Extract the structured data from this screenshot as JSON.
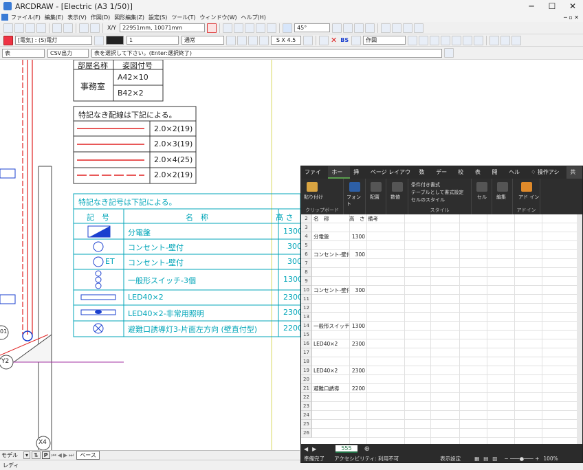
{
  "window": {
    "title": "ARCDRAW - [Electric (A3 1/50)]"
  },
  "menu": [
    "ファイル(F)",
    "編集(E)",
    "表示(V)",
    "作図(D)",
    "図形編集(Z)",
    "設定(S)",
    "ツール(T)",
    "ウィンドウ(W)",
    "ヘルプ(H)"
  ],
  "toolbar1": {
    "coord_label": "X/Y",
    "coord_value": "22951mm,    10071mm",
    "angle_value": "45°"
  },
  "toolbar2": {
    "layer_value": "[電気] : (S)電灯",
    "line_value": "1",
    "linetype_value": "通常",
    "scale_value": "S X 4.5",
    "bs_label": "BS",
    "mode_value": "作図"
  },
  "toolbar3": {
    "type_value": "表",
    "output_value": "CSV出力",
    "prompt_text": "表を選択して下さい。(Enter:選択終了)"
  },
  "cad": {
    "room_table": {
      "header_room": "部屋名称",
      "header_code": "姿図付号",
      "room": "事務室",
      "row1": "A42×10",
      "row2": "B42×2"
    },
    "wire_table": {
      "title": "特記なき配線は下記による。",
      "rows": [
        "2.0×2(19)",
        "2.0×3(19)",
        "2.0×4(25)",
        "2.0×2(19)"
      ]
    },
    "symbol_table": {
      "title": "特記なき記号は下記による。",
      "col_symbol": "記　号",
      "col_name": "名　称",
      "col_height": "高 さ",
      "rows": [
        {
          "name": "分電盤",
          "height": "1300"
        },
        {
          "name": "コンセント-壁付",
          "height": "300"
        },
        {
          "name": "コンセント-壁付",
          "height": "300",
          "symbol_text": "ET"
        },
        {
          "name": "一般形スイッチ-3個",
          "height": "1300"
        },
        {
          "name": "LED40×2",
          "height": "2300"
        },
        {
          "name": "LED40×2-非常用照明",
          "height": "2300"
        },
        {
          "name": "避難口誘導灯3-片面左方向 (壁直付型)",
          "height": "2200"
        }
      ]
    },
    "labels": {
      "y2": "Y2",
      "x4": "X4",
      "n01": "01"
    }
  },
  "bottom_tabs": {
    "model": "モデル",
    "p": "P",
    "base": "ベース"
  },
  "statusbar_text": "レディ",
  "excel": {
    "tabs": [
      "ファイル",
      "ホーム",
      "挿入",
      "ページ レイアウト",
      "数式",
      "データ",
      "校閲",
      "表示",
      "開発",
      "ヘルプ",
      "操作アシス",
      "共有"
    ],
    "active_tab": "ホーム",
    "ribbon": {
      "paste": "貼り付け",
      "clipboard": "クリップボード",
      "font": "フォント",
      "align": "配置",
      "number": "数値",
      "cond_format": "条件付き書式",
      "table_format": "テーブルとして書式設定",
      "cell_style": "セルのスタイル",
      "style_group": "スタイル",
      "cells": "セル",
      "edit": "編集",
      "addin": "アド イン",
      "addin_group": "アドイン"
    },
    "header_row": {
      "a": "名　称",
      "b": "高　さ",
      "c": "備考"
    },
    "rows": [
      {
        "n": "2",
        "a": "名　称",
        "b": "高　さ",
        "c": "備考"
      },
      {
        "n": "3",
        "a": "",
        "b": "",
        "c": ""
      },
      {
        "n": "4",
        "a": "分電盤",
        "b": "1300",
        "c": ""
      },
      {
        "n": "5",
        "a": "",
        "b": "",
        "c": ""
      },
      {
        "n": "6",
        "a": "コンセント-壁付",
        "b": "300",
        "c": ""
      },
      {
        "n": "7",
        "a": "",
        "b": "",
        "c": ""
      },
      {
        "n": "8",
        "a": "",
        "b": "",
        "c": ""
      },
      {
        "n": "9",
        "a": "",
        "b": "",
        "c": ""
      },
      {
        "n": "10",
        "a": "コンセント-壁付",
        "b": "300",
        "c": ""
      },
      {
        "n": "11",
        "a": "",
        "b": "",
        "c": ""
      },
      {
        "n": "12",
        "a": "",
        "b": "",
        "c": ""
      },
      {
        "n": "13",
        "a": "",
        "b": "",
        "c": ""
      },
      {
        "n": "14",
        "a": "一般形スイッチ",
        "b": "1300",
        "c": ""
      },
      {
        "n": "15",
        "a": "",
        "b": "",
        "c": ""
      },
      {
        "n": "16",
        "a": "LED40×2",
        "b": "2300",
        "c": ""
      },
      {
        "n": "17",
        "a": "",
        "b": "",
        "c": ""
      },
      {
        "n": "18",
        "a": "",
        "b": "",
        "c": ""
      },
      {
        "n": "19",
        "a": "LED40×2",
        "b": "2300",
        "c": ""
      },
      {
        "n": "20",
        "a": "",
        "b": "",
        "c": ""
      },
      {
        "n": "21",
        "a": "避難口誘導",
        "b": "2200",
        "c": ""
      },
      {
        "n": "22",
        "a": "",
        "b": "",
        "c": ""
      },
      {
        "n": "23",
        "a": "",
        "b": "",
        "c": ""
      },
      {
        "n": "24",
        "a": "",
        "b": "",
        "c": ""
      },
      {
        "n": "25",
        "a": "",
        "b": "",
        "c": ""
      },
      {
        "n": "26",
        "a": "",
        "b": "",
        "c": ""
      }
    ],
    "sheet_name": "555",
    "status_ready": "準備完了",
    "status_access": "アクセシビリティ: 利用不可",
    "status_view": "表示設定",
    "zoom": "100%"
  },
  "colors": {
    "cad_cyan": "#00a5b8",
    "cad_red": "#e02020",
    "cad_blue": "#1a3fcf",
    "excel_green": "#5a9e4e"
  }
}
